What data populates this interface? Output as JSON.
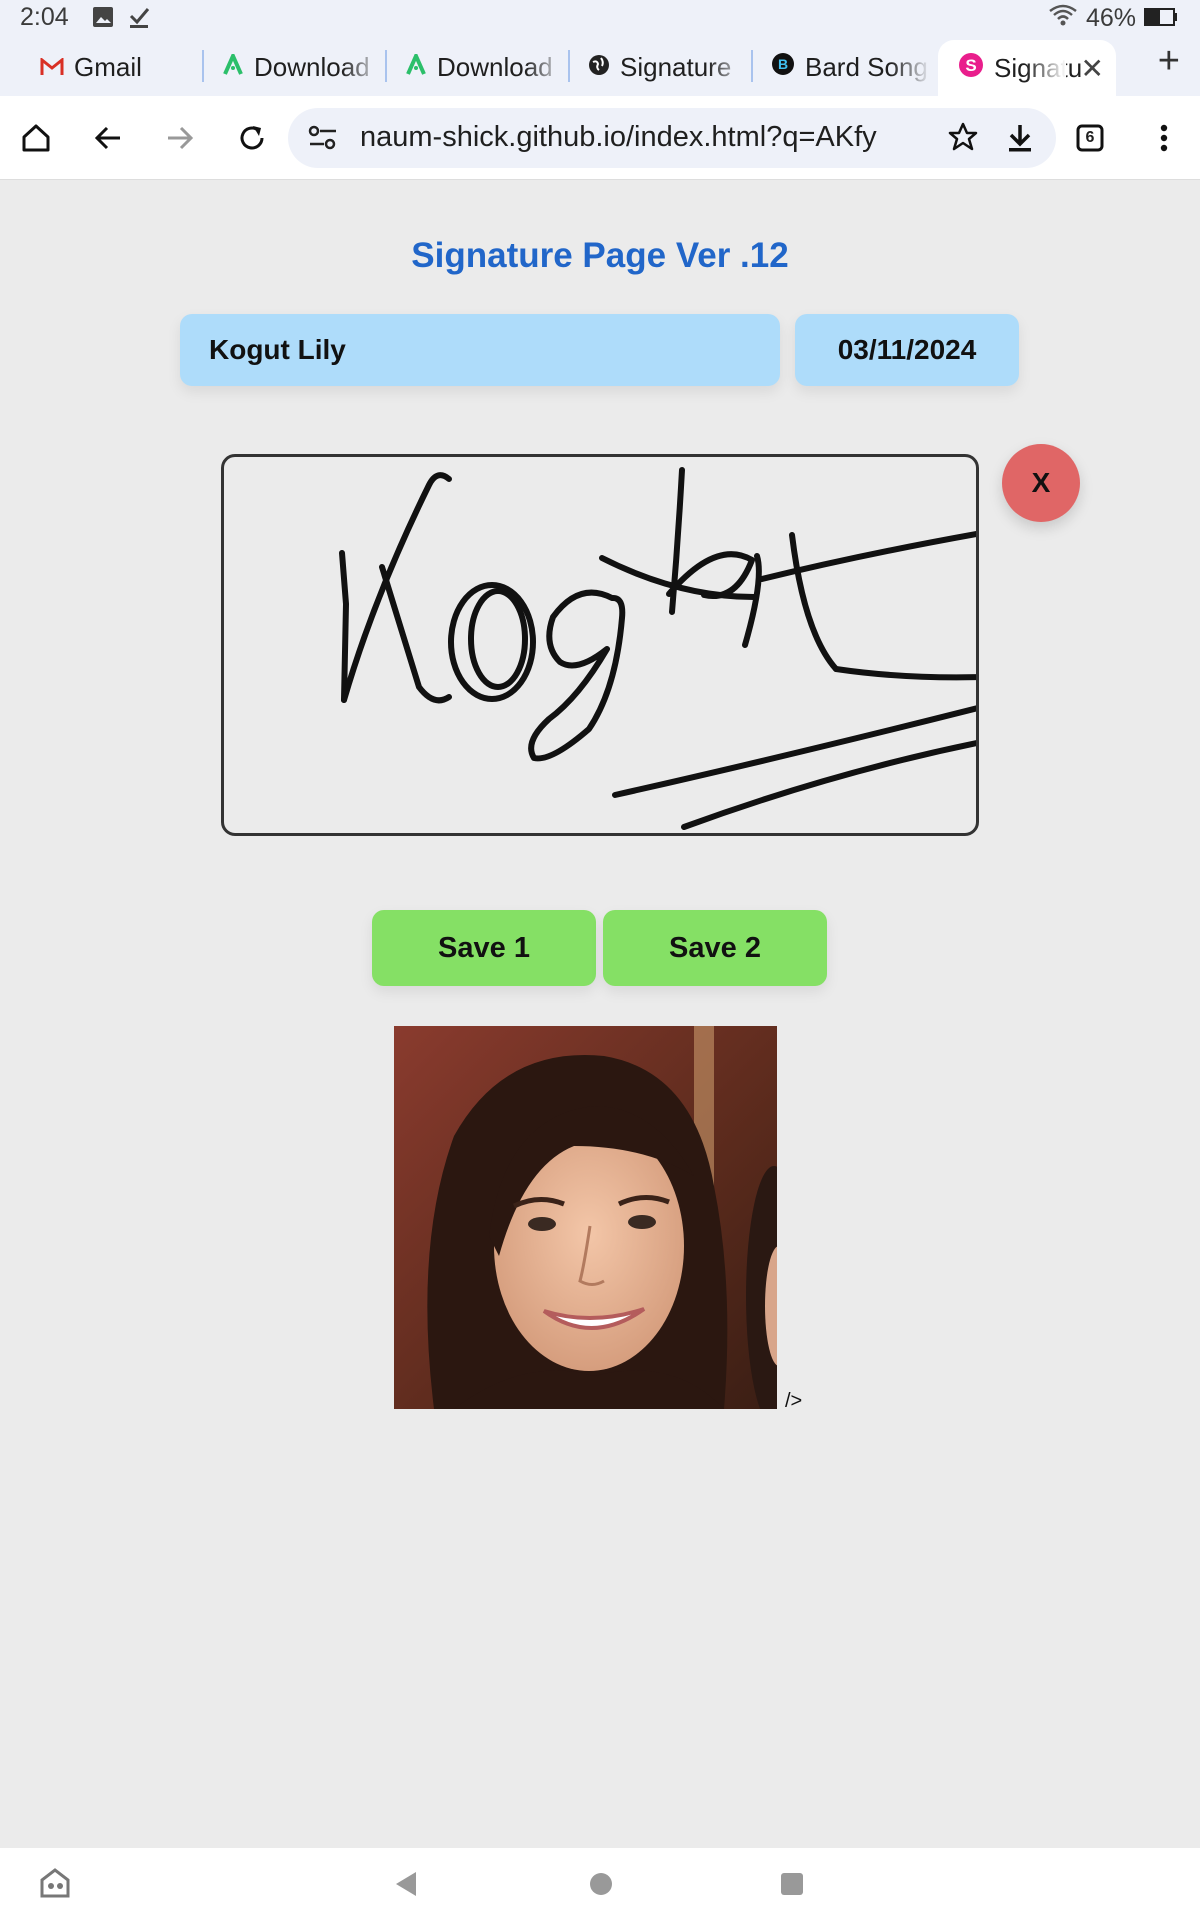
{
  "status_bar": {
    "time": "2:04",
    "battery": "46%"
  },
  "tabs": [
    {
      "label": "Gmail",
      "icon": "gmail-icon",
      "active": false
    },
    {
      "label": "Download",
      "icon": "android-icon",
      "active": false
    },
    {
      "label": "Download",
      "icon": "android-icon",
      "active": false
    },
    {
      "label": "Signature",
      "icon": "globe-icon",
      "active": false
    },
    {
      "label": "Bard Song",
      "icon": "bard-icon",
      "active": false
    },
    {
      "label": "Signatu",
      "icon": "s-icon",
      "active": true
    }
  ],
  "toolbar": {
    "url": "naum-shick.github.io/index.html?q=AKfy",
    "tab_count": "6"
  },
  "page": {
    "title": "Signature Page Ver .12",
    "name_value": "Kogut Lily",
    "date_value": "03/11/2024",
    "clear_label": "X",
    "save1_label": "Save 1",
    "save2_label": "Save 2",
    "stray_text": "/>"
  },
  "colors": {
    "title": "#2166c9",
    "field_bg": "#aedcfa",
    "save_bg": "#85e065",
    "clear_bg": "#e06666",
    "page_bg": "#ebebeb"
  }
}
